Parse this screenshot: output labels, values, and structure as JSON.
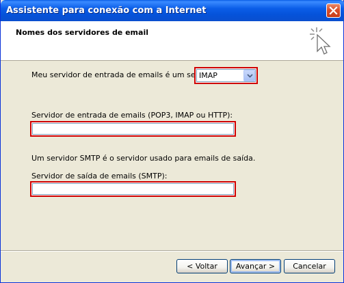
{
  "window": {
    "title": "Assistente para conexão com a Internet"
  },
  "header": {
    "title": "Nomes dos servidores de email",
    "icon": "wizard-cursor-icon"
  },
  "form": {
    "incoming_type_label": "Meu servidor de entrada de emails é um  servidor",
    "incoming_type_value": "IMAP",
    "incoming_server_label": "Servidor de entrada de emails (POP3, IMAP ou HTTP):",
    "incoming_server_value": "",
    "smtp_note": "Um servidor SMTP é o servidor usado para emails de saída.",
    "outgoing_server_label": "Servidor de saída de emails (SMTP):",
    "outgoing_server_value": ""
  },
  "buttons": {
    "back": "< Voltar",
    "next": "Avançar >",
    "cancel": "Cancelar"
  },
  "colors": {
    "highlight_border": "#d00000",
    "titlebar": "#0552d9",
    "dialog_bg": "#ece9d8"
  }
}
